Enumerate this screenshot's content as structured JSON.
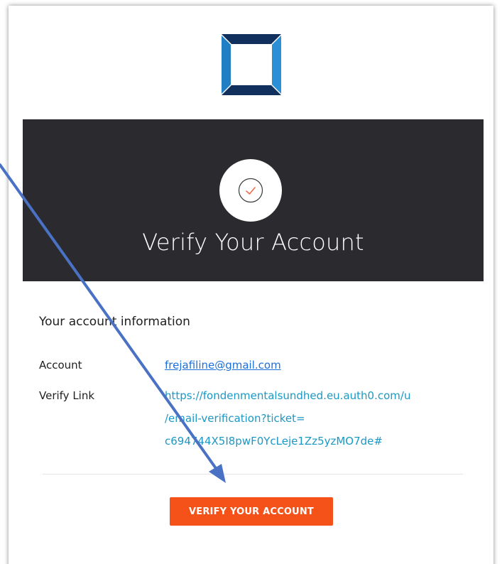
{
  "banner": {
    "title": "Verify Your Account"
  },
  "account_info": {
    "heading": "Your account information",
    "account_label": "Account",
    "account_value": "frejafiline@gmail.com",
    "verify_label": "Verify Link",
    "verify_link_lines": [
      "https://fondenmentalsundhed.eu.auth0.com/u",
      "/email-verification?ticket=",
      "c694744X5I8pwF0YcLeje1Zz5yzMO7de#"
    ]
  },
  "button": {
    "label": "VERIFY YOUR ACCOUNT"
  },
  "colors": {
    "banner_bg": "#2a2a2f",
    "button_bg": "#f5521a",
    "link": "#1b98c4",
    "logo_dark": "#12305e",
    "logo_light": "#1f7ec4",
    "annotation_arrow": "#4a72c4"
  },
  "icons": {
    "logo": "square-frame-logo-icon",
    "check": "checkmark-circle-icon",
    "arrow": "annotation-arrow-icon"
  }
}
